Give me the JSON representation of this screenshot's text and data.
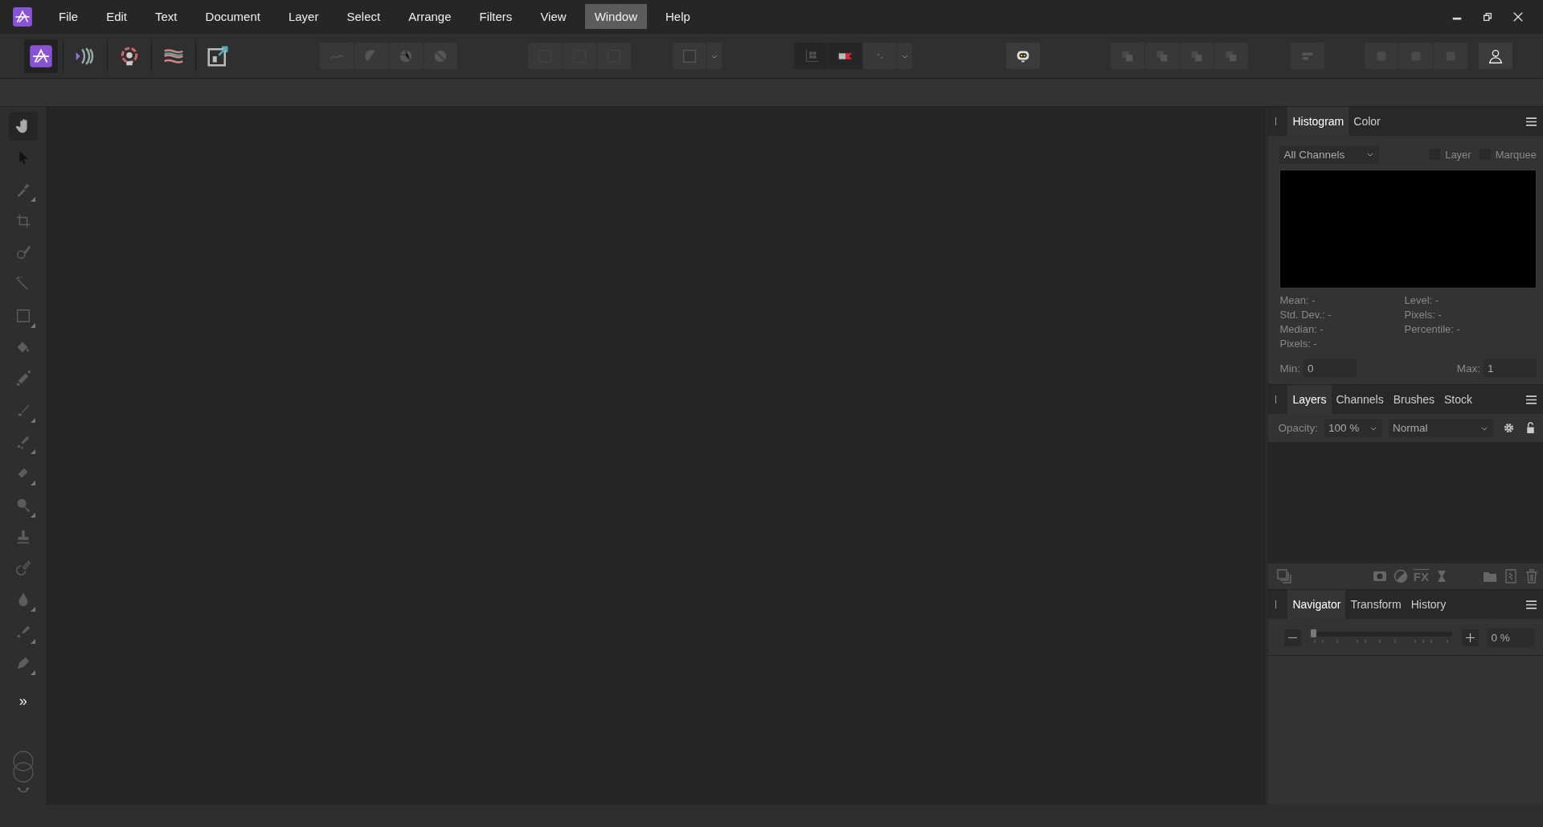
{
  "menu": [
    {
      "label": "File",
      "selected": false
    },
    {
      "label": "Edit",
      "selected": false
    },
    {
      "label": "Text",
      "selected": false
    },
    {
      "label": "Document",
      "selected": false
    },
    {
      "label": "Layer",
      "selected": false
    },
    {
      "label": "Select",
      "selected": false
    },
    {
      "label": "Arrange",
      "selected": false
    },
    {
      "label": "Filters",
      "selected": false
    },
    {
      "label": "View",
      "selected": false
    },
    {
      "label": "Window",
      "selected": true
    },
    {
      "label": "Help",
      "selected": false
    }
  ],
  "personas": [
    {
      "kind": "photo",
      "selected": true
    },
    {
      "kind": "liquify",
      "selected": false
    },
    {
      "kind": "develop",
      "selected": false
    },
    {
      "kind": "tone",
      "selected": false
    },
    {
      "kind": "export",
      "selected": false
    }
  ],
  "tools": [
    {
      "kind": "hand",
      "selected": true,
      "flyout": false
    },
    {
      "kind": "pointer",
      "selected": false,
      "flyout": false
    },
    {
      "kind": "picker",
      "selected": false,
      "flyout": true
    },
    {
      "kind": "crop",
      "selected": false,
      "flyout": false
    },
    {
      "kind": "selection-brush",
      "selected": false,
      "flyout": false
    },
    {
      "kind": "wand",
      "selected": false,
      "flyout": false
    },
    {
      "kind": "marquee",
      "selected": false,
      "flyout": true
    },
    {
      "kind": "fill",
      "selected": false,
      "flyout": false
    },
    {
      "kind": "gradient",
      "selected": false,
      "flyout": false
    },
    {
      "kind": "brush",
      "selected": false,
      "flyout": true
    },
    {
      "kind": "spray",
      "selected": false,
      "flyout": true
    },
    {
      "kind": "eraser",
      "selected": false,
      "flyout": true
    },
    {
      "kind": "dodge",
      "selected": false,
      "flyout": true
    },
    {
      "kind": "stamp",
      "selected": false,
      "flyout": false
    },
    {
      "kind": "redeye",
      "selected": false,
      "flyout": false
    },
    {
      "kind": "blur",
      "selected": false,
      "flyout": true
    },
    {
      "kind": "retouch",
      "selected": false,
      "flyout": true
    },
    {
      "kind": "pen",
      "selected": false,
      "flyout": true
    }
  ],
  "more_tools": "»",
  "histogram_panel": {
    "tabs": [
      {
        "label": "Histogram",
        "selected": true
      },
      {
        "label": "Color",
        "selected": false
      }
    ],
    "channel_select": "All Channels",
    "checkboxes": [
      {
        "label": "Layer",
        "checked": false
      },
      {
        "label": "Marquee",
        "checked": false
      }
    ],
    "stats_left": [
      "Mean: -",
      "Std. Dev.: -",
      "Median: -",
      "Pixels: -"
    ],
    "stats_right": [
      "Level: -",
      "Pixels: -",
      "Percentile: -"
    ],
    "min": {
      "label": "Min:",
      "value": "0"
    },
    "max": {
      "label": "Max:",
      "value": "1"
    }
  },
  "layers_panel": {
    "tabs": [
      {
        "label": "Layers",
        "selected": true
      },
      {
        "label": "Channels",
        "selected": false
      },
      {
        "label": "Brushes",
        "selected": false
      },
      {
        "label": "Stock",
        "selected": false
      }
    ],
    "opacity_label": "Opacity:",
    "opacity": "100 %",
    "blend_mode": "Normal",
    "fx_label": "FX"
  },
  "navigator_panel": {
    "tabs": [
      {
        "label": "Navigator",
        "selected": true
      },
      {
        "label": "Transform",
        "selected": false
      },
      {
        "label": "History",
        "selected": false
      }
    ],
    "zoom": {
      "level": 0
    },
    "zoom_value": "0 %"
  }
}
